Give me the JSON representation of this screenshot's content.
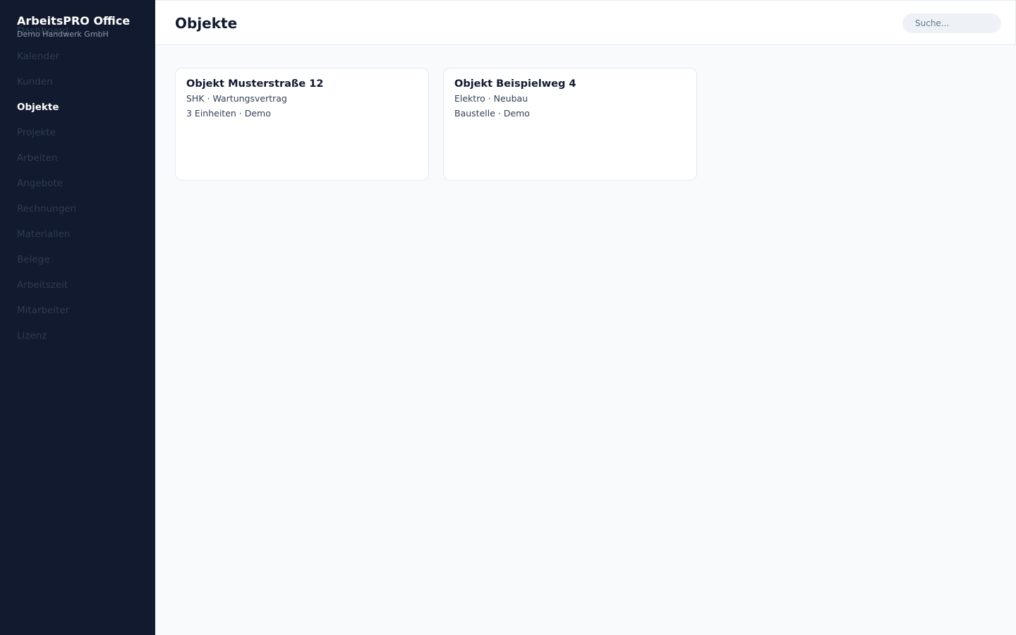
{
  "app": {
    "title": "ArbeitsPRO Office",
    "company": "Demo Handwerk GmbH"
  },
  "sidebar": {
    "items": [
      {
        "label": "Dashboard"
      },
      {
        "label": "Kalender"
      },
      {
        "label": "Kunden"
      },
      {
        "label": "Objekte",
        "active": true
      },
      {
        "label": "Projekte"
      },
      {
        "label": "Arbeiten"
      },
      {
        "label": "Angebote"
      },
      {
        "label": "Rechnungen"
      },
      {
        "label": "Materialien"
      },
      {
        "label": "Belege"
      },
      {
        "label": "Arbeitszeit"
      },
      {
        "label": "Mitarbeiter"
      },
      {
        "label": "Lizenz"
      }
    ]
  },
  "header": {
    "title": "Objekte",
    "search_placeholder": "Suche..."
  },
  "objects": [
    {
      "title": "Objekt Musterstraße 12",
      "line1": "SHK · Wartungsvertrag",
      "line2": "3 Einheiten · Demo"
    },
    {
      "title": "Objekt Beispielweg 4",
      "line1": "Elektro · Neubau",
      "line2": "Baustelle · Demo"
    }
  ],
  "colors": {
    "sidebar_bg": "#111a2e",
    "main_bg": "#f8fafc",
    "active_text": "#ffffff",
    "inactive_text": "#2f3c52"
  }
}
